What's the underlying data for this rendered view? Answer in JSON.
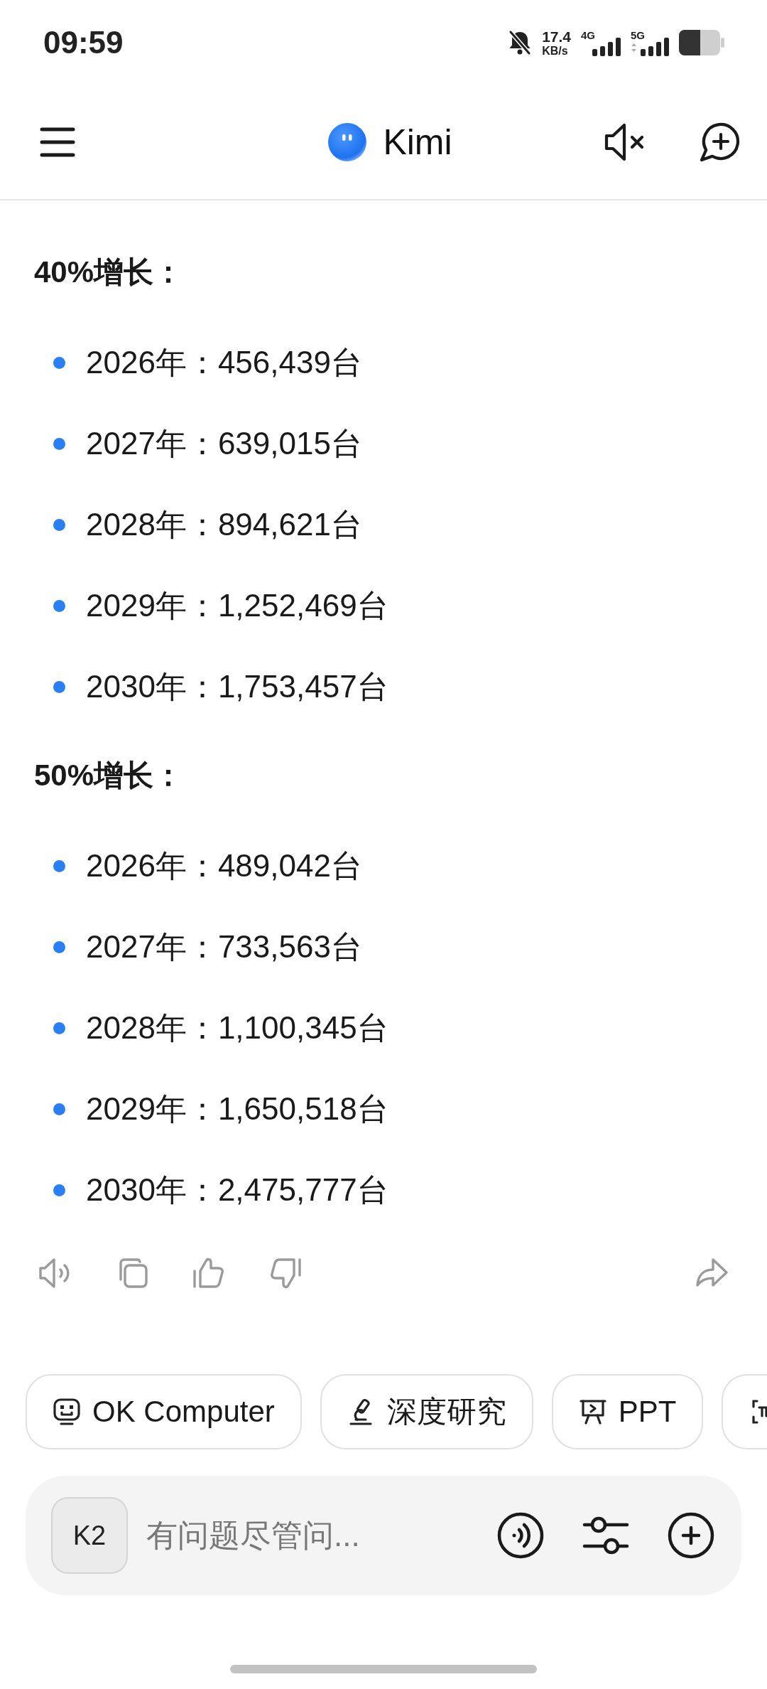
{
  "status_bar": {
    "time": "09:59",
    "speed_value": "17.4",
    "speed_unit": "KB/s",
    "network_1": "4G",
    "network_2": "5G"
  },
  "header": {
    "title": "Kimi"
  },
  "message": {
    "sections": [
      {
        "heading": "40%增长：",
        "items": [
          "2026年：456,439台",
          "2027年：639,015台",
          "2028年：894,621台",
          "2029年：1,252,469台",
          "2030年：1,753,457台"
        ]
      },
      {
        "heading": "50%增长：",
        "items": [
          "2026年：489,042台",
          "2027年：733,563台",
          "2028年：1,100,345台",
          "2029年：1,650,518台",
          "2030年：2,475,777台"
        ]
      }
    ]
  },
  "suggestions": [
    {
      "label": "OK Computer"
    },
    {
      "label": "深度研究"
    },
    {
      "label": "PPT"
    }
  ],
  "composer": {
    "model": "K2",
    "placeholder": "有问题尽管问..."
  }
}
